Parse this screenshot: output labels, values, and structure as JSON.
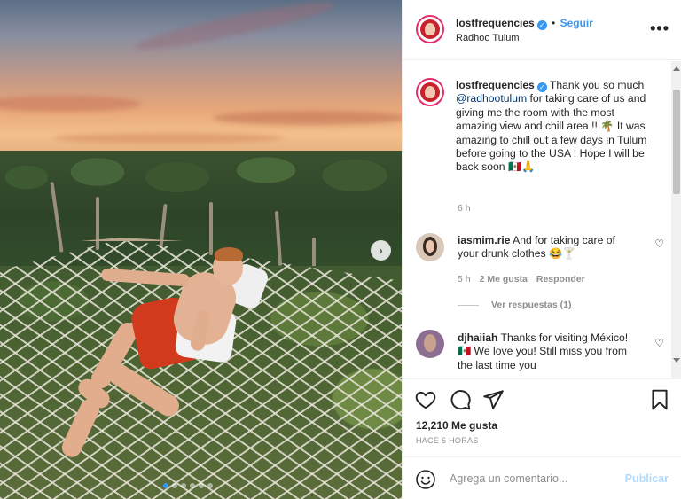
{
  "post": {
    "author": "lostfrequencies",
    "location": "Radhoo Tulum",
    "follow_label": "Seguir",
    "separator": "•",
    "more_label": "•••"
  },
  "photo": {
    "alt": "Man lying on a rope net hammock above jungle at sunset",
    "carousel_next": "›",
    "slides_total": 6,
    "slide_active": 1
  },
  "caption": {
    "author": "lostfrequencies",
    "text_before_mention": "Thank you so much ",
    "mention": "@radhootulum",
    "text_after_mention": " for taking care of us and giving me the room with the most amazing view and chill area !! 🌴 It was amazing to chill out a few days in Tulum before going to the USA ! Hope I will be back soon 🇲🇽🙏",
    "time": "6 h"
  },
  "comments": [
    {
      "author": "iasmim.rie",
      "text": "And for taking care of your drunk clothes 😂🍸",
      "time": "5 h",
      "likes": "2 Me gusta",
      "reply": "Responder",
      "view_replies": "Ver respuestas (1)"
    },
    {
      "author": "djhaiiah",
      "text": "Thanks for visiting México! 🇲🇽 We love you! Still miss you from the last time you"
    }
  ],
  "stats": {
    "likes": "12,210 Me gusta",
    "timestamp": "HACE 6 HORAS"
  },
  "add_comment": {
    "placeholder": "Agrega un comentario...",
    "publish": "Publicar"
  },
  "colors": {
    "link_blue": "#3897f0",
    "publish_disabled": "#b3dbff",
    "story_ring": "#e1306c",
    "verified": "#3897f0"
  }
}
